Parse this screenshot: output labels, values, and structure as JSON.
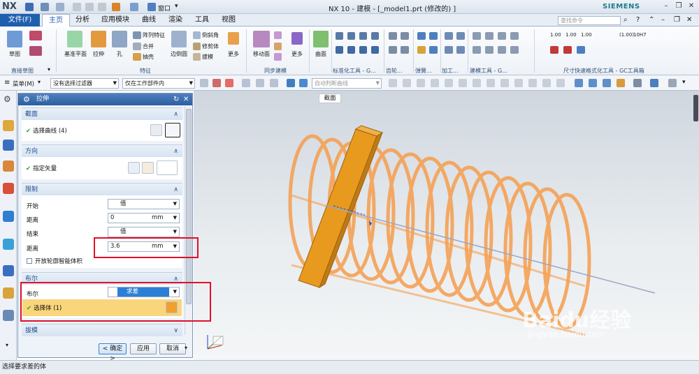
{
  "app": {
    "logo": "NX",
    "title": "NX 10 - 建模 - [_model1.prt  (修改的) ]",
    "brand": "SIEMENS"
  },
  "quickaccess": {
    "window_menu": "窗口"
  },
  "tabs": {
    "file": "文件(F)",
    "items": [
      "主页",
      "分析",
      "应用模块",
      "曲线",
      "渲染",
      "工具",
      "视图"
    ],
    "search_placeholder": "查找命令"
  },
  "ribbon": {
    "sketch": "草图",
    "datum_plane": "基准平面",
    "extrude": "拉伸",
    "hole": "孔",
    "pattern_feature": "阵列特征",
    "unite": "合并",
    "shell": "抽壳",
    "edge_blend": "边倒圆",
    "chamfer": "倒斜角",
    "trim_body": "修剪体",
    "draft": "拔模",
    "more1": "更多",
    "move_face": "移动面",
    "more2": "更多",
    "surface": "曲面",
    "more3": "更多",
    "dim_labels": [
      "1.00",
      "1.00",
      "1.00",
      "(1.00)",
      "10H7"
    ],
    "groups": {
      "direct_sketch": "直接草图",
      "feature": "特征",
      "sync": "同步建模",
      "std_tools": "标准化工具 - G...",
      "gear": "齿轮...",
      "spring": "弹簧...",
      "machining": "加工...",
      "model_tools": "建模工具 - G...",
      "dimension": "尺寸快速格式化工具 - GC工具箱"
    }
  },
  "toolbar2": {
    "menu": "菜单(M)",
    "filter": "没有选择过滤器",
    "scope": "仅在工作部件内",
    "snap": "自动判断曲线"
  },
  "dialog": {
    "title": "拉伸",
    "sections": {
      "section": {
        "label": "截面",
        "select_curve": "选择曲线 (4)"
      },
      "direction": {
        "label": "方向",
        "vector": "指定矢量"
      },
      "limits": {
        "label": "限制",
        "start": "开始",
        "start_value": "值",
        "distance1": "距离",
        "distance1_value": "0",
        "unit1": "mm",
        "end": "结束",
        "end_value": "值",
        "distance2": "距离",
        "distance2_value": "3.6",
        "unit2": "mm",
        "open_profile": "开放轮廓智能体积"
      },
      "boolean": {
        "label": "布尔",
        "boolean_label": "布尔",
        "boolean_value": "求差",
        "select_body": "选择体 (1)"
      },
      "draft": {
        "label": "拔模"
      }
    },
    "ok": "< 确定 >",
    "apply": "应用",
    "cancel": "取消"
  },
  "viewport": {
    "tooltip": "截面"
  },
  "status": {
    "message": "选择要求差的体"
  },
  "watermark": {
    "brand": "Baidu经验",
    "url": "jingyan.baidu.com"
  },
  "colors": {
    "accent": "#1f5fae",
    "spring": "#f5a052",
    "highlight": "#e0102a",
    "body": "#e89a1e"
  }
}
